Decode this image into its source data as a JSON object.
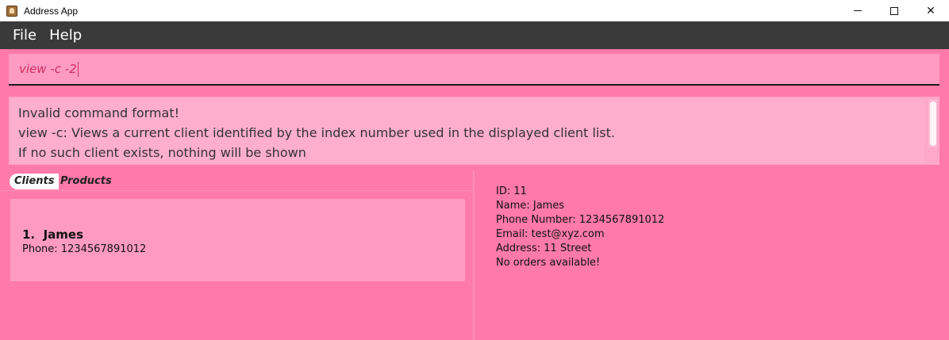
{
  "window": {
    "title": "Address App",
    "minimize_label": "",
    "close_label": "✕"
  },
  "menu": {
    "items": [
      "File",
      "Help"
    ]
  },
  "command": {
    "value": "view -c -2"
  },
  "result": {
    "lines": [
      "Invalid command format!",
      "view -c: Views a current client identified by the index number used in the displayed client list.",
      "If no such client exists, nothing will be shown"
    ]
  },
  "tabs": [
    {
      "label": "Clients",
      "selected": true
    },
    {
      "label": "Products",
      "selected": false
    }
  ],
  "clients": [
    {
      "index": "1.",
      "name": "James",
      "phone": "Phone: 1234567891012"
    }
  ],
  "details": {
    "lines": [
      "ID: 11",
      "Name: James",
      "Phone Number: 1234567891012",
      "Email: test@xyz.com",
      "Address: 11 Street",
      "No orders available!"
    ]
  },
  "colors": {
    "background": "#ff7aa8",
    "menubar": "#3a3a3a",
    "command_box": "#ff9bc3",
    "command_text": "#d12e5f",
    "result_box": "#ffaecd",
    "card": "#ff9bc3"
  }
}
